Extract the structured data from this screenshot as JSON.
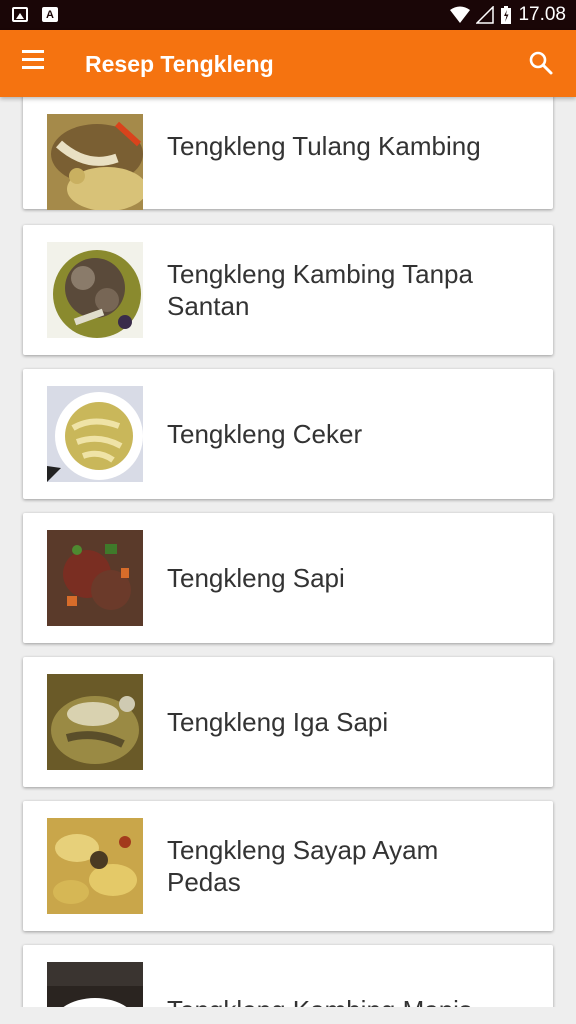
{
  "status_bar": {
    "time": "17.08"
  },
  "app_bar": {
    "title": "Resep Tengkleng"
  },
  "colors": {
    "accent": "#f57310",
    "status_bar": "#1a0607",
    "background": "#eeeeee",
    "card": "#ffffff",
    "text": "#333333"
  },
  "recipes": [
    {
      "title": "Tengkleng Tulang Kambing"
    },
    {
      "title": "Tengkleng Kambing Tanpa Santan"
    },
    {
      "title": "Tengkleng Ceker"
    },
    {
      "title": "Tengkleng Sapi"
    },
    {
      "title": "Tengkleng Iga Sapi"
    },
    {
      "title": "Tengkleng Sayap Ayam Pedas"
    },
    {
      "title": "Tengkleng Kambing Manis"
    }
  ]
}
